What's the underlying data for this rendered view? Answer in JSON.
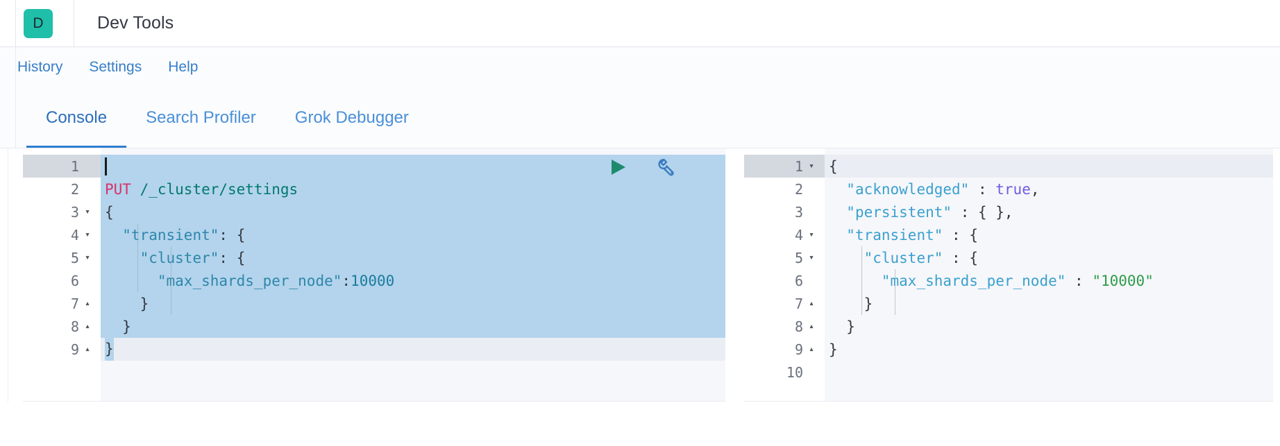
{
  "header": {
    "badge_letter": "D",
    "title": "Dev Tools",
    "badge_color": "#1fbfa9"
  },
  "top_links": [
    {
      "label": "History",
      "name": "history"
    },
    {
      "label": "Settings",
      "name": "settings"
    },
    {
      "label": "Help",
      "name": "help"
    }
  ],
  "tabs": [
    {
      "label": "Console",
      "active": true
    },
    {
      "label": "Search Profiler",
      "active": false
    },
    {
      "label": "Grok Debugger",
      "active": false
    }
  ],
  "request_editor": {
    "name": "console-request-editor",
    "active_line": 1,
    "lines": [
      {
        "n": "1",
        "fold": "",
        "text": ""
      },
      {
        "n": "2",
        "fold": "",
        "text": "PUT /_cluster/settings"
      },
      {
        "n": "3",
        "fold": "▾",
        "text": "{"
      },
      {
        "n": "4",
        "fold": "▾",
        "text": "  \"transient\": {"
      },
      {
        "n": "5",
        "fold": "▾",
        "text": "    \"cluster\": {"
      },
      {
        "n": "6",
        "fold": "",
        "text": "      \"max_shards_per_node\":10000"
      },
      {
        "n": "7",
        "fold": "▴",
        "text": "    }"
      },
      {
        "n": "8",
        "fold": "▴",
        "text": "  }"
      },
      {
        "n": "9",
        "fold": "▴",
        "text": "}"
      }
    ],
    "method": "PUT",
    "url": "/_cluster/settings",
    "body_keys": [
      "transient",
      "cluster",
      "max_shards_per_node"
    ],
    "body_value": "10000"
  },
  "response_editor": {
    "name": "console-response-editor",
    "active_line": 1,
    "lines": [
      {
        "n": "1",
        "fold": "▾",
        "text": "{"
      },
      {
        "n": "2",
        "fold": "",
        "text": "  \"acknowledged\" : true,"
      },
      {
        "n": "3",
        "fold": "",
        "text": "  \"persistent\" : { },"
      },
      {
        "n": "4",
        "fold": "▾",
        "text": "  \"transient\" : {"
      },
      {
        "n": "5",
        "fold": "▾",
        "text": "    \"cluster\" : {"
      },
      {
        "n": "6",
        "fold": "",
        "text": "      \"max_shards_per_node\" : \"10000\""
      },
      {
        "n": "7",
        "fold": "▴",
        "text": "    }"
      },
      {
        "n": "8",
        "fold": "▴",
        "text": "  }"
      },
      {
        "n": "9",
        "fold": "▴",
        "text": "}"
      },
      {
        "n": "10",
        "fold": "",
        "text": ""
      }
    ],
    "acknowledged": "true",
    "persistent": "{ }",
    "max_shards_per_node": "10000"
  },
  "actions": {
    "play_label": "Click to send request",
    "play_color": "#1d8a6e",
    "wrench_label": "Open documentation",
    "wrench_color": "#3a7cc0"
  }
}
